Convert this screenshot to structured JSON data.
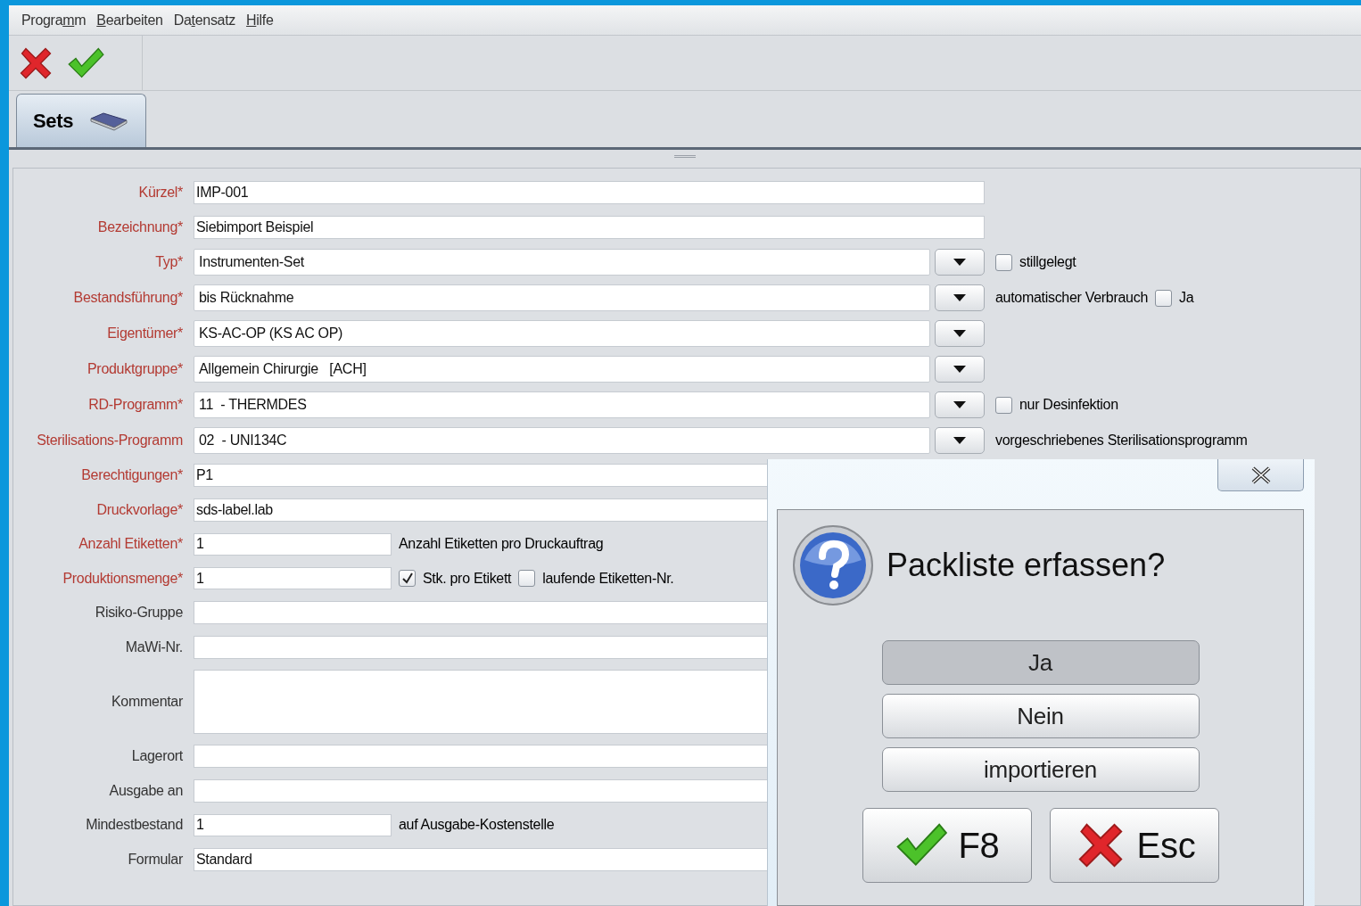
{
  "menu": [
    {
      "before": "Progra",
      "key": "m",
      "after": "m"
    },
    {
      "key": "B",
      "after": "earbeiten"
    },
    {
      "before": "Da",
      "key": "t",
      "after": "ensatz"
    },
    {
      "key": "H",
      "after": "ilfe"
    }
  ],
  "toolbar": [
    {
      "kind": "cancel"
    },
    {
      "kind": "confirm"
    }
  ],
  "tabs": [
    {
      "label": "Sets",
      "selected": true
    }
  ],
  "fields": [
    {
      "label": "Kürzel*",
      "required": true,
      "kind": "text",
      "value": "IMP-001"
    },
    {
      "label": "Bezeichnung*",
      "required": true,
      "kind": "text",
      "value": "Siebimport Beispiel"
    },
    {
      "label": "Typ*",
      "required": true,
      "kind": "combo",
      "value": "Instrumenten-Set",
      "extras": [
        {
          "kind": "checkbox",
          "label": "stillgelegt",
          "checked": false
        }
      ]
    },
    {
      "label": "Bestandsführung*",
      "required": true,
      "kind": "combo",
      "value": "bis Rücknahme",
      "extras": [
        {
          "kind": "note",
          "label": "automatischer Verbrauch"
        },
        {
          "kind": "checkbox",
          "label": "Ja",
          "checked": false
        }
      ]
    },
    {
      "label": "Eigentümer*",
      "required": true,
      "kind": "combo",
      "value": "KS-AC-OP (KS AC OP)"
    },
    {
      "label": "Produktgruppe*",
      "required": true,
      "kind": "combo",
      "value": "Allgemein Chirurgie   [ACH]"
    },
    {
      "label": "RD-Programm*",
      "required": true,
      "kind": "combo",
      "value": "11  - THERMDES",
      "extras": [
        {
          "kind": "checkbox",
          "label": "nur Desinfektion",
          "checked": false
        }
      ]
    },
    {
      "label": "Sterilisations-Programm",
      "required": true,
      "kind": "combo",
      "value": "02  - UNI134C",
      "extras": [
        {
          "kind": "note",
          "label": "vorgeschriebenes Sterilisationsprogramm"
        }
      ]
    },
    {
      "label": "Berechtigungen*",
      "required": true,
      "kind": "text",
      "value": "P1"
    },
    {
      "label": "Druckvorlage*",
      "required": true,
      "kind": "text",
      "value": "sds-label.lab"
    },
    {
      "label": "Anzahl Etiketten*",
      "required": true,
      "kind": "short",
      "value": "1",
      "extras": [
        {
          "kind": "note",
          "label": "Anzahl Etiketten pro Druckauftrag"
        }
      ]
    },
    {
      "label": "Produktionsmenge*",
      "required": true,
      "kind": "short",
      "value": "1",
      "extras": [
        {
          "kind": "checkbox",
          "label": "Stk. pro Etikett",
          "checked": true
        },
        {
          "kind": "checkbox",
          "label": "laufende Etiketten-Nr.",
          "checked": false
        }
      ]
    },
    {
      "label": "Risiko-Gruppe",
      "required": false,
      "kind": "text"
    },
    {
      "label": "MaWi-Nr.",
      "required": false,
      "kind": "text"
    },
    {
      "label": "Kommentar",
      "required": false,
      "kind": "area"
    },
    {
      "label": "Lagerort",
      "required": false,
      "kind": "text"
    },
    {
      "label": "Ausgabe an",
      "required": false,
      "kind": "text"
    },
    {
      "label": "Mindestbestand",
      "required": false,
      "kind": "short",
      "value": "1",
      "extras": [
        {
          "kind": "note",
          "label": "auf Ausgabe-Kostenstelle"
        }
      ]
    },
    {
      "label": "Formular",
      "required": false,
      "kind": "text",
      "value": "Standard"
    }
  ],
  "dialog": {
    "title": "Packliste erfassen?",
    "options": [
      {
        "label": "Ja",
        "selected": true
      },
      {
        "label": "Nein",
        "selected": false
      },
      {
        "label": "importieren",
        "selected": false
      }
    ],
    "actions": [
      {
        "kind": "confirm",
        "label": "F8"
      },
      {
        "kind": "cancel",
        "label": "Esc"
      }
    ]
  }
}
